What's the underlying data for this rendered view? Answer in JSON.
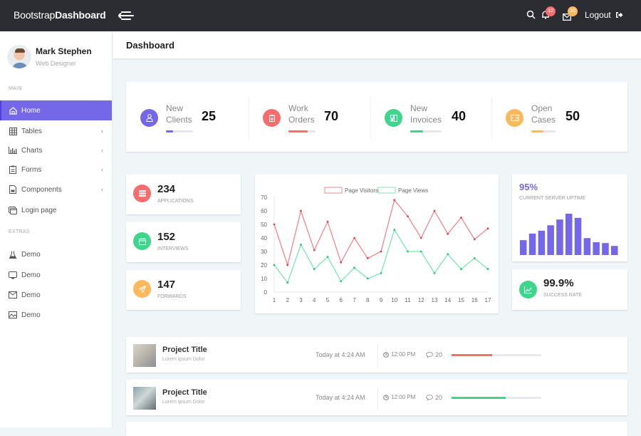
{
  "topbar": {
    "brand_light": "Bootstrap",
    "brand_bold": "Dashboard",
    "icons": {
      "menu": "hamburger-arrow-icon",
      "search": "search-icon",
      "notifications": "bell-icon",
      "messages": "envelope-icon",
      "logout": "sign-out-icon"
    },
    "notification_count": "12",
    "message_count": "10",
    "logout_label": "Logout"
  },
  "profile": {
    "name": "Mark Stephen",
    "role": "Web Designer"
  },
  "sidebar": {
    "main_label": "MAIN",
    "main_items": [
      {
        "label": "Home",
        "icon": "home-icon",
        "active": true,
        "expandable": false
      },
      {
        "label": "Tables",
        "icon": "grid-icon",
        "active": false,
        "expandable": true
      },
      {
        "label": "Charts",
        "icon": "bar-chart-icon",
        "active": false,
        "expandable": true
      },
      {
        "label": "Forms",
        "icon": "clipboard-icon",
        "active": false,
        "expandable": true
      },
      {
        "label": "Components",
        "icon": "file-icon",
        "active": false,
        "expandable": true
      },
      {
        "label": "Login page",
        "icon": "window-icon",
        "active": false,
        "expandable": false
      }
    ],
    "extras_label": "EXTRAS",
    "extras_items": [
      {
        "label": "Demo",
        "icon": "flask-icon"
      },
      {
        "label": "Demo",
        "icon": "monitor-icon"
      },
      {
        "label": "Demo",
        "icon": "mail-icon"
      },
      {
        "label": "Demo",
        "icon": "image-icon"
      }
    ],
    "chevron": "‹"
  },
  "header": {
    "title": "Dashboard"
  },
  "stats": [
    {
      "line1": "New",
      "line2": "Clients",
      "value": "25",
      "progress": 25,
      "color": "#7468e8",
      "icon": "user-icon"
    },
    {
      "line1": "Work",
      "line2": "Orders",
      "value": "70",
      "progress": 70,
      "color": "#f76c6c",
      "icon": "clipboard-icon"
    },
    {
      "line1": "New",
      "line2": "Invoices",
      "value": "40",
      "progress": 40,
      "color": "#3ed68a",
      "icon": "invoice-icon"
    },
    {
      "line1": "Open",
      "line2": "Cases",
      "value": "50",
      "progress": 50,
      "color": "#fdb85c",
      "icon": "ticket-icon"
    }
  ],
  "mini_cards": [
    {
      "value": "234",
      "caption": "APPLICATIONS",
      "color": "#f76c6c",
      "icon": "list-icon"
    },
    {
      "value": "152",
      "caption": "INTERVIEWS",
      "color": "#3ed68a",
      "icon": "calendar-icon"
    },
    {
      "value": "147",
      "caption": "FORWARDS",
      "color": "#fdb85c",
      "icon": "paper-plane-icon"
    }
  ],
  "uptime": {
    "value": "95%",
    "caption": "CURRENT SERVER UPTIME",
    "bars": [
      36,
      52,
      59,
      72,
      86,
      100,
      90,
      41,
      31,
      29,
      22
    ],
    "color": "#7468e8"
  },
  "success": {
    "value": "99.9%",
    "caption": "SUCCESS RATE",
    "color": "#3ed68a",
    "icon": "trend-chart-icon"
  },
  "chart_data": {
    "type": "line",
    "title": "",
    "xlabel": "",
    "ylabel": "",
    "x": [
      1,
      2,
      3,
      4,
      5,
      6,
      7,
      8,
      9,
      10,
      11,
      12,
      13,
      14,
      15,
      16,
      17
    ],
    "ylim": [
      0,
      70
    ],
    "yticks": [
      0,
      10,
      20,
      30,
      40,
      50,
      60,
      70
    ],
    "legend": "top-center",
    "grid": false,
    "series": [
      {
        "name": "Page Visitors",
        "color": "#f5868c",
        "values": [
          50,
          20,
          60,
          31,
          52,
          22,
          40,
          25,
          30,
          68,
          56,
          40,
          60,
          43,
          55,
          39,
          47
        ]
      },
      {
        "name": "Page Views",
        "color": "#7be8b3",
        "values": [
          20,
          7,
          35,
          17,
          26,
          8,
          18,
          10,
          14,
          46,
          30,
          30,
          14,
          28,
          17,
          25,
          17
        ]
      }
    ]
  },
  "projects": [
    {
      "title": "Project Title",
      "subtitle": "Lorem Ipsum Dolor",
      "time": "Today at 4:24 AM",
      "clock": "12:00 PM",
      "comments": "20",
      "progress": 45,
      "color": "#f76c6c"
    },
    {
      "title": "Project Title",
      "subtitle": "Lorem Ipsum Dolor",
      "time": "Today at 4:24 AM",
      "clock": "12:00 PM",
      "comments": "20",
      "progress": 60,
      "color": "#3ed68a"
    }
  ]
}
